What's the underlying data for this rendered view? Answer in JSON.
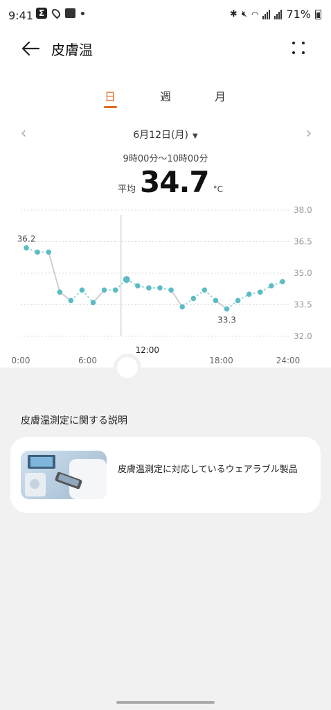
{
  "status": {
    "time": "9:41",
    "battery": "71%"
  },
  "appbar": {
    "title": "皮膚温"
  },
  "tabs": [
    {
      "label": "日",
      "active": true
    },
    {
      "label": "週"
    },
    {
      "label": "月"
    }
  ],
  "date": {
    "label": "6月12日(月)"
  },
  "summary": {
    "range": "9時00分～10時00分",
    "avg_label": "平均",
    "avg_value": "34.7",
    "unit": "°C"
  },
  "chart_data": {
    "type": "line",
    "ylim": [
      32.0,
      38.0
    ],
    "y_ticks": [
      "38.0",
      "36.5",
      "35.0",
      "33.5",
      "32.0"
    ],
    "x_ticks": [
      "0:00",
      "6:00",
      "12:00",
      "18:00",
      "24:00"
    ],
    "selected_x": "9:00",
    "series": [
      {
        "x": [
          0.5,
          1.5,
          2.5,
          3.5,
          4.5,
          5.5,
          6.5,
          7.5,
          8.5,
          9.5,
          10.5,
          11.5,
          12.5,
          13.5,
          14.5,
          15.5,
          16.5,
          17.5,
          18.5,
          19.5,
          20.5,
          21.5,
          22.5,
          23.5
        ],
        "values": [
          36.2,
          36.0,
          36.0,
          34.1,
          33.7,
          34.2,
          33.6,
          34.2,
          34.2,
          34.7,
          34.4,
          34.3,
          34.3,
          34.2,
          33.4,
          33.8,
          34.2,
          33.7,
          33.3,
          33.7,
          34.0,
          34.1,
          34.4,
          34.6
        ],
        "highlight": 9
      }
    ],
    "annotations": [
      {
        "text": "36.2",
        "index": 0
      },
      {
        "text": "33.3",
        "index": 18
      }
    ]
  },
  "info": {
    "section_title": "皮膚温測定に関する説明",
    "card_text": "皮膚温測定に対応しているウェアラブル製品"
  },
  "colors": {
    "accent": "#e06a1f",
    "series": "#5bbcc4"
  }
}
